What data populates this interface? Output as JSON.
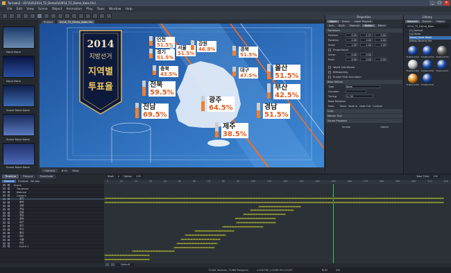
{
  "window": {
    "title": "Tornado2 - [D:\\\\\\\\4\\\\2014_T2_Demo\\\\\\\\2014_T2_Demo_Kobs.t2s]",
    "controls": [
      "_",
      "□",
      "✕"
    ]
  },
  "menu": [
    "File",
    "Edit",
    "View",
    "Scene",
    "Object",
    "Animation",
    "Play",
    "Tools",
    "Window",
    "Help"
  ],
  "view_tabs": [
    "Project",
    "2014_T2_Demo_Kobs.t2s"
  ],
  "canvas_status": {
    "mode": "Camera",
    "zoom": "81%",
    "fps": "30fps"
  },
  "scenes": [
    {
      "label": "None.None"
    },
    {
      "label": "None.None"
    },
    {
      "label": "Scene\nNone.None"
    },
    {
      "label": "Scene\nNone.None"
    },
    {
      "label": "Scene\nNone.None"
    },
    {
      "label": "None.None"
    }
  ],
  "graphic": {
    "year": "2014",
    "line1": "지방선거",
    "line2": "지역별",
    "line3": "투표율",
    "regions": [
      {
        "name": "인천",
        "pct": "51.5%",
        "fill": 0.52
      },
      {
        "name": "서울",
        "pct": "51.5%",
        "fill": 0.52
      },
      {
        "name": "강원",
        "pct": "46.9%",
        "fill": 0.47
      },
      {
        "name": "경기",
        "pct": "51.5%",
        "fill": 0.52
      },
      {
        "name": "경북",
        "pct": "51.5%",
        "fill": 0.52
      },
      {
        "name": "충북",
        "pct": "43.5%",
        "fill": 0.44
      },
      {
        "name": "대구",
        "pct": "47.5%",
        "fill": 0.48
      },
      {
        "name": "울산",
        "pct": "51.5%",
        "fill": 0.52
      },
      {
        "name": "전북",
        "pct": "59.5%",
        "fill": 0.6
      },
      {
        "name": "부산",
        "pct": "42.5%",
        "fill": 0.43
      },
      {
        "name": "전남",
        "pct": "69.5%",
        "fill": 0.7
      },
      {
        "name": "광주",
        "pct": "64.5%",
        "fill": 0.65
      },
      {
        "name": "경남",
        "pct": "51.5%",
        "fill": 0.52
      },
      {
        "name": "제주",
        "pct": "38.5%",
        "fill": 0.39
      }
    ]
  },
  "properties": {
    "header": "Properties",
    "tabs": [
      "Object",
      "Scene",
      "Layer Playout"
    ],
    "subtabs": [
      "Info",
      "Style",
      "Material",
      "Motion",
      "Effect",
      "Timeline"
    ],
    "transform_label": "Transform",
    "position": [
      "0.00",
      "-1.37",
      "0.00"
    ],
    "rotation": [
      "0.00",
      "0.00",
      "0.00"
    ],
    "scale": [
      "1.00",
      "1.00",
      "1.00"
    ],
    "position_label": "Position",
    "rotation_label": "Rotation",
    "scale_label": "Scale",
    "proportional": "Proportional",
    "shear_label": "Shear",
    "shear": [
      "0.00",
      "0.00"
    ],
    "pivot_label": "Pivot",
    "pivot": [
      "0.00",
      "0.00",
      "0.00"
    ],
    "world_coord": "World Coordinate",
    "billboarding": "Billboarding",
    "enable_path": "Enable Path Animation",
    "base_motion": "Base Motion",
    "type_label": "Type",
    "type_value": "None",
    "duration_label": "Duration",
    "timing_label": "Timing",
    "timing_value": "1 / 30",
    "base_rotation": "Base Rotation",
    "fade_label": "Fade",
    "fade_opts": [
      "None",
      "Fade In",
      "Fade Out",
      "Custom"
    ],
    "sections": [
      "Crop",
      "Motion Trail",
      "Sound Playback"
    ],
    "screen_label": "Screen",
    "object_label": "Object"
  },
  "library": {
    "header": "Library",
    "tabs": [
      "Material",
      "Texture",
      "Object"
    ],
    "path": "2014_T2_Demo_Kobs",
    "tree": [
      "[1] Default",
      "[2] Metal",
      "[Base] Hard Metal",
      "[Base] Normal Me"
    ],
    "swatch_labels": [
      "TU404.0710",
      "TU404.0704",
      "TU404.0730",
      "TU404.0760",
      "TU404.0750",
      "TU404.0707",
      "TU404.0700",
      "TU404.0740"
    ]
  },
  "timeline": {
    "tabs": [
      "Timeline",
      "Playout",
      "TimeCode"
    ],
    "subtabs": [
      "General",
      "Everpas",
      "Set Key"
    ],
    "start_label": "Start",
    "start_value": "0",
    "option_label": "Option",
    "option_value": "220",
    "total_label": "Total Time",
    "total_value": "220",
    "ruler": [
      "0",
      "10",
      "20",
      "30",
      "40",
      "50",
      "60",
      "70",
      "80",
      "90",
      "100",
      "110",
      "120",
      "130",
      "140",
      "150",
      "160",
      "170",
      "180",
      "190",
      "200",
      "210",
      "220"
    ],
    "tracks": [
      "Scene",
      "Transform",
      "Material",
      "Camera",
      "경기",
      "충북",
      "강원",
      "전남",
      "전북",
      "경남",
      "경북",
      "대구",
      "광주",
      "부산",
      "울산",
      "제주",
      "서울",
      "인천",
      "Event 1"
    ],
    "bottom_select": "Default"
  },
  "status": {
    "vertices": "71444 Vertices, 71086 Polygons",
    "coords": "x:150738, y:1049.95 z:25.67",
    "num": "NUM",
    "ins": "INS"
  }
}
